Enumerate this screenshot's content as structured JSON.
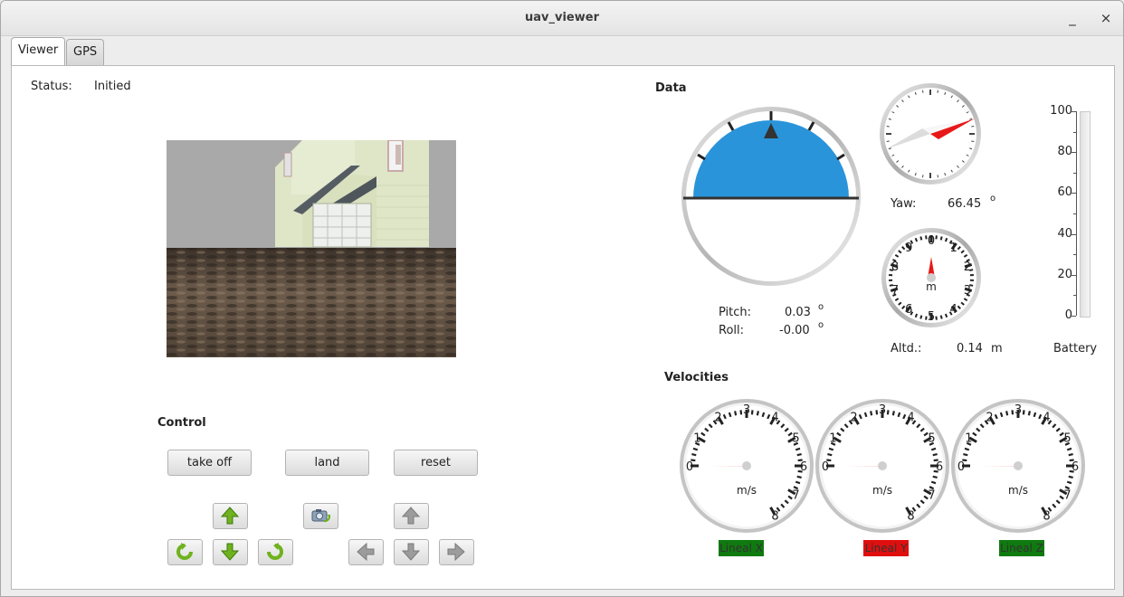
{
  "window": {
    "title": "uav_viewer",
    "minimize_glyph": "_",
    "close_glyph": "×"
  },
  "tabs": [
    {
      "label": "Viewer",
      "active": true
    },
    {
      "label": "GPS",
      "active": false
    }
  ],
  "status": {
    "label": "Status:",
    "value": "Initied"
  },
  "control": {
    "title": "Control",
    "takeoff_label": "take off",
    "land_label": "land",
    "reset_label": "reset"
  },
  "data_panel": {
    "title": "Data",
    "pitch_label": "Pitch:",
    "pitch_value": "0.03",
    "pitch_unit": "o",
    "roll_label": "Roll:",
    "roll_value": "-0.00",
    "roll_unit": "o",
    "yaw_label": "Yaw:",
    "yaw_value": "66.45",
    "yaw_unit": "o",
    "altitude_label": "Altd.:",
    "altitude_value": "0.14",
    "altitude_unit": "m",
    "altimeter_unit": "m",
    "altimeter_digits": [
      "0",
      "1",
      "2",
      "3",
      "4",
      "5",
      "6",
      "7",
      "8",
      "9"
    ],
    "battery_label": "Battery",
    "battery_ticks": [
      "100",
      "80",
      "60",
      "40",
      "20",
      "0"
    ],
    "battery_level": 0
  },
  "velocities": {
    "title": "Velocities",
    "gauge_unit": "m/s",
    "gauge_ticks": [
      "0",
      "1",
      "2",
      "3",
      "4",
      "5",
      "6",
      "7",
      "8"
    ],
    "gauges": [
      {
        "label": "Lineal X",
        "color": "#0f7a0f",
        "value": 0
      },
      {
        "label": "Lineal Y",
        "color": "#e00f0f",
        "value": 0
      },
      {
        "label": "Lineal Z",
        "color": "#0f7a0f",
        "value": 0
      }
    ]
  },
  "icons": {
    "forward": "arrow-up-icon",
    "backward": "arrow-down-icon",
    "rotate_left": "rotate-left-icon",
    "rotate_right": "rotate-right-icon",
    "camera": "camera-switch-icon",
    "up": "arrow-up-icon",
    "down": "arrow-down-icon",
    "left": "arrow-left-icon",
    "right": "arrow-right-icon"
  },
  "colors": {
    "horizon_sky": "#2a94da",
    "needle": "#e81818",
    "green_arrow": "#6fb21e"
  }
}
